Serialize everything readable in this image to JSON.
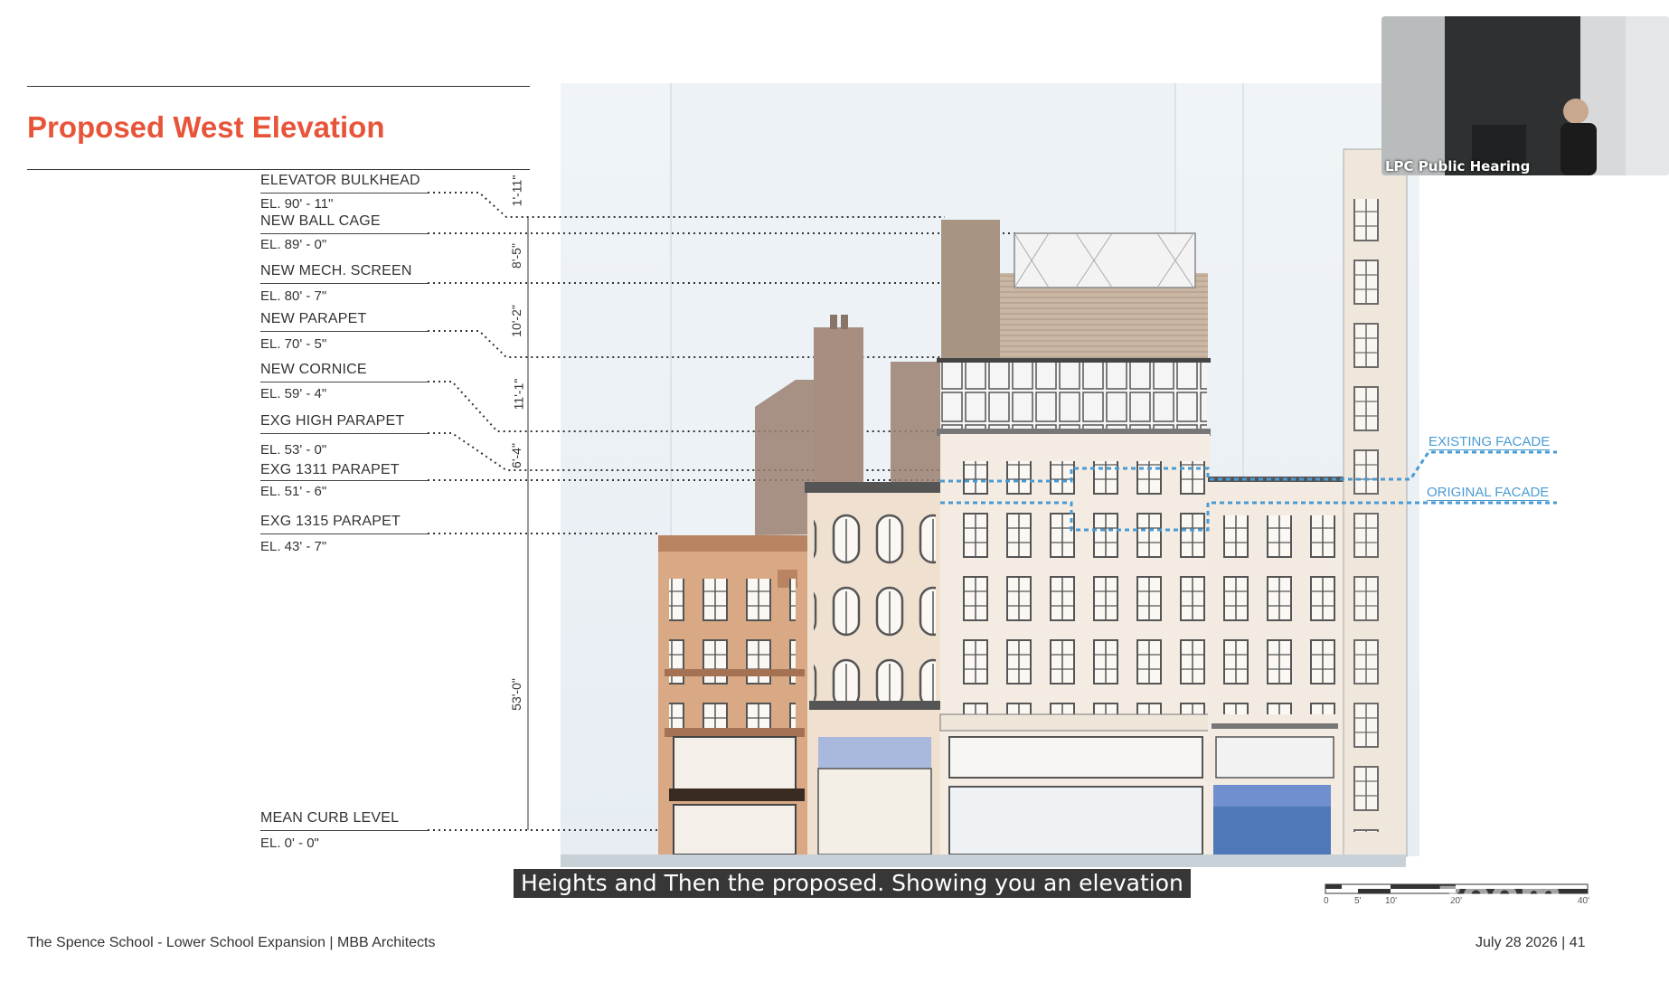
{
  "slide": {
    "title": "Proposed West Elevation",
    "levels": [
      {
        "name": "ELEVATOR BULKHEAD",
        "elevation": "EL. 90' - 11\""
      },
      {
        "name": "NEW BALL CAGE",
        "elevation": "EL. 89' - 0\""
      },
      {
        "name": "NEW MECH. SCREEN",
        "elevation": "EL. 80' - 7\""
      },
      {
        "name": "NEW PARAPET",
        "elevation": "EL. 70' - 5\""
      },
      {
        "name": "NEW CORNICE",
        "elevation": "EL. 59' - 4\""
      },
      {
        "name": "EXG HIGH PARAPET",
        "elevation": "EL. 53' - 0\""
      },
      {
        "name": "EXG 1311 PARAPET",
        "elevation": "EL. 51' - 6\""
      },
      {
        "name": "EXG 1315 PARAPET",
        "elevation": "EL. 43' - 7\""
      },
      {
        "name": "MEAN CURB LEVEL",
        "elevation": "EL. 0' - 0\""
      }
    ],
    "dimensions": [
      "1'-11\"",
      "8'-5\"",
      "10'-2\"",
      "11'-1\"",
      "6'-4\"",
      "53'-0\""
    ],
    "facade_labels": {
      "existing": "EXISTING FACADE",
      "original": "ORIGINAL FACADE"
    },
    "scale_ticks": [
      "0",
      "5'",
      "10'",
      "20'",
      "40'"
    ],
    "footer_left": "The Spence School - Lower School Expansion |  MBB Architects",
    "footer_right": "July 28 2026  | 41"
  },
  "meeting": {
    "video_label": "LPC Public Hearing",
    "caption": "Heights and Then the proposed. Showing you an elevation",
    "watermark": "zoom"
  },
  "colors": {
    "accent": "#e8543a",
    "facade_line": "#4a9bd3"
  }
}
